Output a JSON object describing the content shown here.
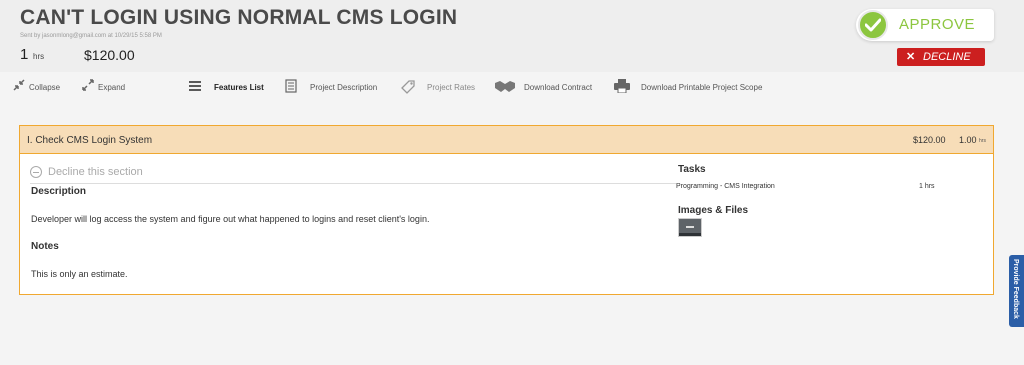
{
  "header": {
    "title": "CAN'T LOGIN USING NORMAL CMS LOGIN",
    "sent_by": "Sent by jasonmlong@gmail.com at 10/29/15 5:58 PM",
    "hours_value": "1",
    "hours_unit": "hrs",
    "total": "$120.00"
  },
  "actions": {
    "approve_label": "APPROVE",
    "decline_label": "DECLINE",
    "approve_color": "#8cc63f",
    "decline_color": "#cc1f1f"
  },
  "toolbar": {
    "collapse": "Collapse",
    "expand": "Expand",
    "features_list": "Features List",
    "project_description": "Project Description",
    "project_rates": "Project Rates",
    "download_contract": "Download Contract",
    "download_scope": "Download Printable Project Scope"
  },
  "section": {
    "title": "I. Check CMS Login System",
    "price": "$120.00",
    "hours": "1.00",
    "hours_unit": "hrs",
    "decline_label": "Decline this section",
    "description_label": "Description",
    "description_text": "Developer will log access the system and figure out what happened to logins and reset client's login.",
    "notes_label": "Notes",
    "notes_text": "This is only an estimate.",
    "tasks_label": "Tasks",
    "tasks": [
      {
        "name": "Programming - CMS Integration",
        "hours": "1 hrs"
      }
    ],
    "images_label": "Images & Files",
    "border_color": "#f0a830",
    "header_color": "#f7ddb8"
  },
  "feedback_tab": "Provide Feedback"
}
